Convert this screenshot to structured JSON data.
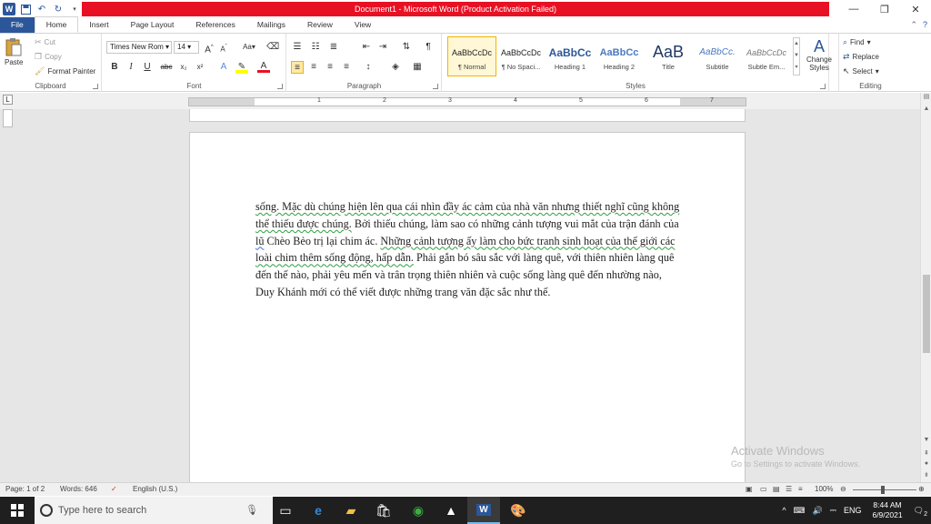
{
  "window": {
    "title": "Document1 - Microsoft Word (Product Activation Failed)",
    "app_icon": "W",
    "qat_icons": [
      "save-icon",
      "undo-icon",
      "redo-icon",
      "customize-icon"
    ]
  },
  "tabs": [
    {
      "label": "File"
    },
    {
      "label": "Home"
    },
    {
      "label": "Insert"
    },
    {
      "label": "Page Layout"
    },
    {
      "label": "References"
    },
    {
      "label": "Mailings"
    },
    {
      "label": "Review"
    },
    {
      "label": "View"
    }
  ],
  "ribbon": {
    "clipboard": {
      "label": "Clipboard",
      "paste": "Paste",
      "cut": "Cut",
      "copy": "Copy",
      "format_painter": "Format Painter"
    },
    "font": {
      "label": "Font",
      "font_name": "Times New Rom",
      "font_size": "14",
      "bold": "B",
      "italic": "I",
      "underline": "U",
      "strike": "abc",
      "subscript": "x₂",
      "superscript": "x²",
      "change_case": "Aa"
    },
    "paragraph": {
      "label": "Paragraph"
    },
    "styles": {
      "label": "Styles",
      "items": [
        {
          "sample": "AaBbCcDc",
          "name": "¶ Normal"
        },
        {
          "sample": "AaBbCcDc",
          "name": "¶ No Spaci..."
        },
        {
          "sample": "AaBbCc",
          "name": "Heading 1"
        },
        {
          "sample": "AaBbCc",
          "name": "Heading 2"
        },
        {
          "sample": "AaB",
          "name": "Title"
        },
        {
          "sample": "AaBbCc.",
          "name": "Subtitle"
        },
        {
          "sample": "AaBbCcDc",
          "name": "Subtle Em..."
        }
      ],
      "change_styles": "Change Styles"
    },
    "editing": {
      "label": "Editing",
      "find": "Find",
      "replace": "Replace",
      "select": "Select"
    }
  },
  "ruler": {
    "numbers": [
      "1",
      "2",
      "3",
      "4",
      "5",
      "6",
      "7"
    ]
  },
  "document": {
    "segments": [
      {
        "text": "sống. Mặc dù chúng hiện lên qua cái nhìn đầy ác cảm của nhà văn nhưng thiết nghĩ cũng không thể thiếu được chúng.",
        "style": "sq"
      },
      {
        "text": " Bởi thiếu chúng, làm sao có những cảnh tượng vui mắt của trận đánh của ",
        "style": ""
      },
      {
        "text": "lũ",
        "style": "sb"
      },
      {
        "text": " Chèo Bẻo trị lại chim ác. ",
        "style": ""
      },
      {
        "text": "Những cảnh tượng ấy làm cho bức tranh sinh hoạt của thế giới các loài chim thêm sống động, hấp dẫn.",
        "style": "sq"
      },
      {
        "text": " Phải gắn bó sâu sắc với làng quê, với thiên nhiên làng quê đến thế nào, phải yêu mến và trân trọng thiên nhiên và cuộc sống làng quê đến nhường nào, Duy Khánh mới có thể viết được những trang văn đặc sắc như thế.",
        "style": ""
      }
    ]
  },
  "watermark": {
    "line1": "Activate Windows",
    "line2": "Go to Settings to activate Windows."
  },
  "status": {
    "page": "Page: 1 of 2",
    "words": "Words: 646",
    "language": "English (U.S.)",
    "zoom": "100%"
  },
  "taskbar": {
    "search_placeholder": "Type here to search",
    "lang": "ENG",
    "time": "8:44 AM",
    "date": "6/9/2021",
    "notification_count": "2"
  }
}
